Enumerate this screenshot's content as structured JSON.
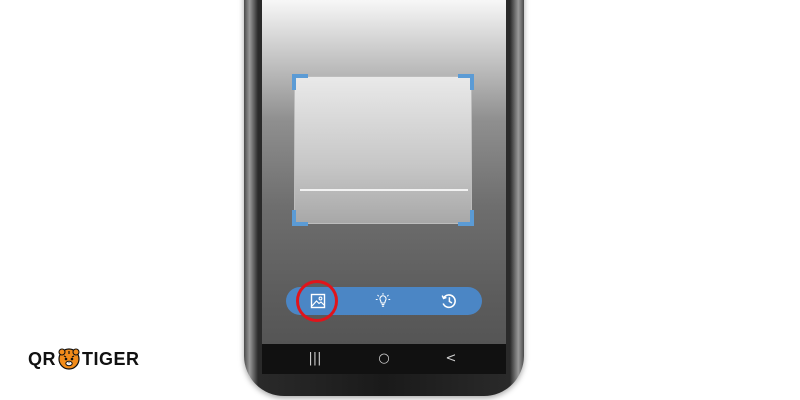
{
  "colors": {
    "accent": "#4b86c5",
    "corner": "#5b9bd5",
    "highlight": "#e0141b"
  },
  "toolbar": {
    "items": [
      {
        "name": "gallery-icon",
        "highlighted": true
      },
      {
        "name": "flashlight-icon",
        "highlighted": false
      },
      {
        "name": "history-icon",
        "highlighted": false
      }
    ]
  },
  "navbar": {
    "recent_glyph": "|||",
    "home_glyph": "○",
    "back_glyph": "<"
  },
  "logo": {
    "left": "QR",
    "right": "TIGER"
  }
}
